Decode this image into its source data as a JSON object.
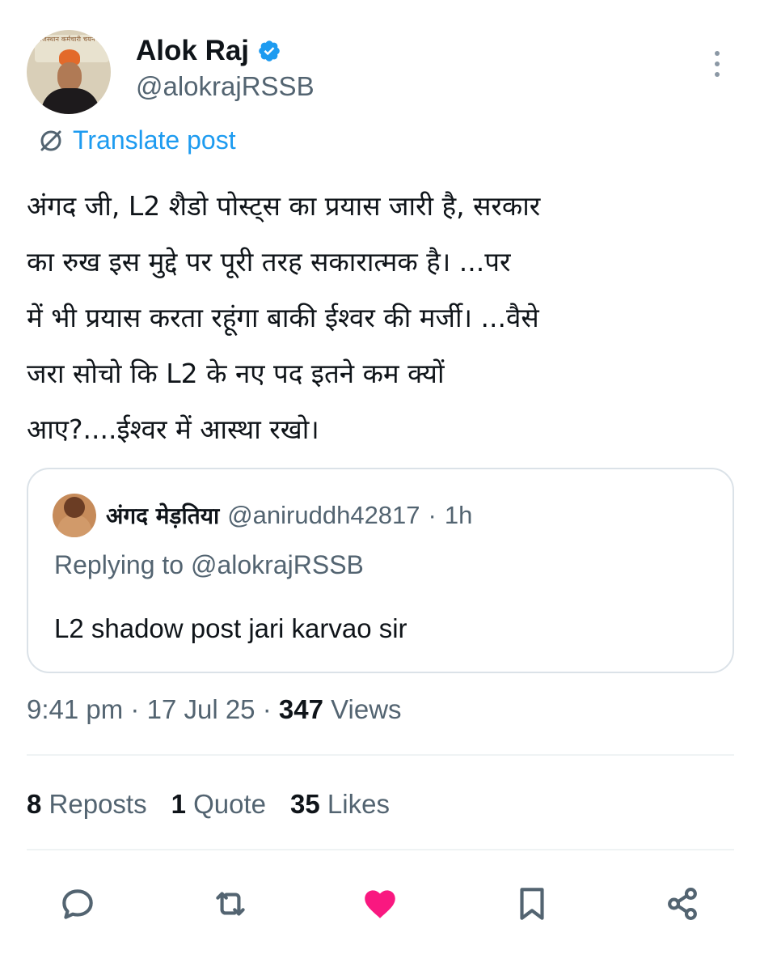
{
  "author": {
    "name": "Alok Raj",
    "handle": "@alokrajRSSB",
    "avatar_board_text": "राजस्थान कर्मचारी चयन बोर्ड"
  },
  "translate_label": "Translate post",
  "post_lines": [
    "अंगद जी, L2 शैडो पोस्ट्स का प्रयास जारी है, सरकार",
    "का रुख इस मुद्दे पर पूरी तरह सकारात्मक है। ...पर",
    "में भी प्रयास करता रहूंगा बाकी ईश्वर की मर्जी। ...वैसे",
    "जरा सोचो कि L2 के नए पद इतने कम क्यों",
    "आए?....ईश्वर में आस्था रखो।"
  ],
  "quoted": {
    "name": "अंगद मेड़तिया",
    "handle": "@aniruddh42817",
    "separator": "·",
    "time": "1h",
    "replying": "Replying to @alokrajRSSB",
    "text": "L2 shadow post jari karvao sir"
  },
  "meta": {
    "time": "9:41 pm",
    "date": "17 Jul 25",
    "views_count": "347",
    "views_label": "Views"
  },
  "stats": {
    "reposts_count": "8",
    "reposts_label": "Reposts",
    "quotes_count": "1",
    "quotes_label": "Quote",
    "likes_count": "35",
    "likes_label": "Likes"
  },
  "icons": {
    "verified": "verified-badge-icon",
    "more": "more-vertical-icon",
    "translate": "globe-slash-icon",
    "reply": "reply-icon",
    "repost": "repost-icon",
    "like": "heart-icon",
    "bookmark": "bookmark-icon",
    "share": "share-icon"
  },
  "colors": {
    "accent": "#1d9bf0",
    "like": "#f91880",
    "secondary_text": "#536471",
    "primary_text": "#0f1419"
  }
}
